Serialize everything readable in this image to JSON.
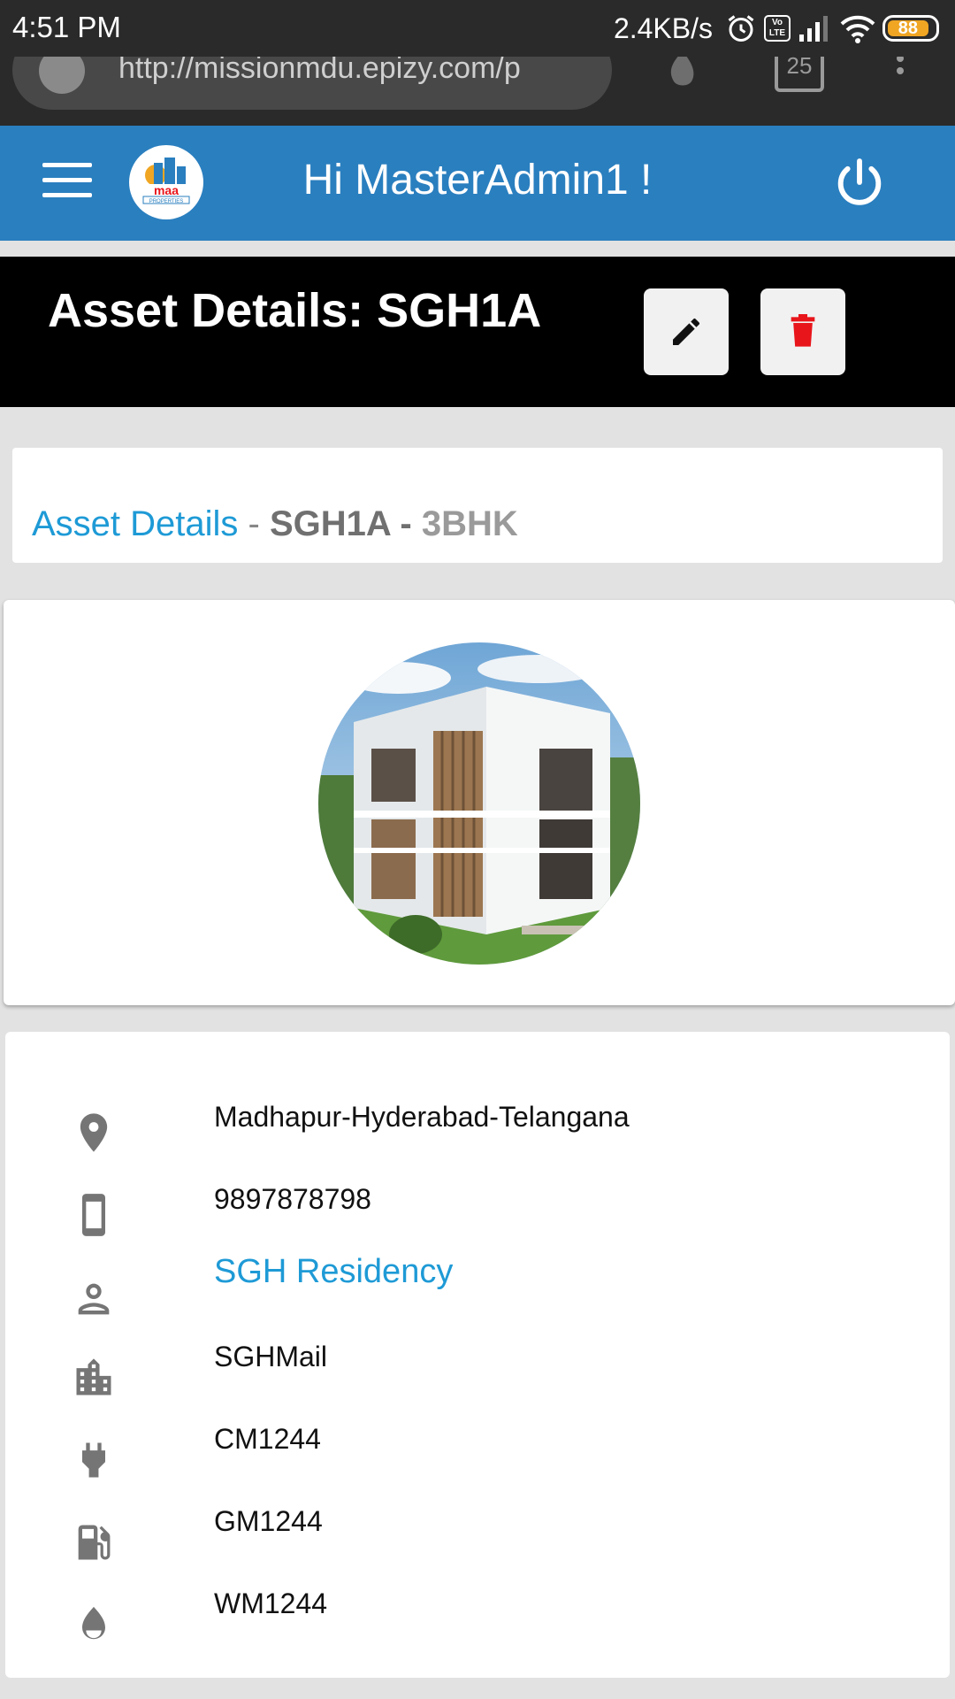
{
  "status_bar": {
    "time": "4:51 PM",
    "network_speed": "2.4KB/s",
    "volte_label": "Vo LTE",
    "battery_level": "88",
    "icons": [
      "alarm-icon",
      "volte-icon",
      "signal-icon",
      "wifi-icon",
      "battery-icon"
    ]
  },
  "browser": {
    "url": "http://missionmdu.epizy.com/p",
    "tab_count": "25"
  },
  "header": {
    "greeting": "Hi MasterAdmin1 !",
    "accent_color": "#2a7fbf"
  },
  "title_bar": {
    "title": "Asset Details: SGH1A",
    "edit_icon": "pencil-icon",
    "delete_icon": "trash-icon",
    "delete_color": "#e8151b"
  },
  "breadcrumb": {
    "link": "Asset Details",
    "sep1": " - ",
    "code": "SGH1A",
    "sep2": " - ",
    "type": "3BHK"
  },
  "details": {
    "location": "Madhapur-Hyderabad-Telangana",
    "phone": "9897878798",
    "owner": "SGH Residency",
    "building": "SGHMail",
    "electric_meter": "CM1244",
    "gas_meter": "GM1244",
    "water_meter": "WM1244"
  }
}
